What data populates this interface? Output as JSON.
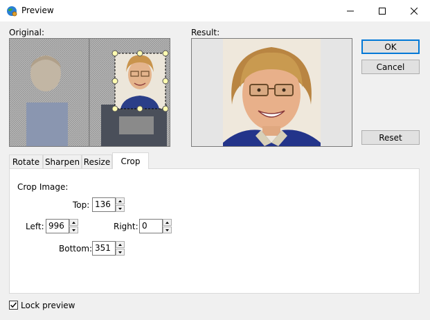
{
  "window": {
    "title": "Preview",
    "minimize_icon": "minimize-icon",
    "maximize_icon": "maximize-icon",
    "close_icon": "close-icon"
  },
  "original": {
    "label": "Original:",
    "image": "portrait-photo-with-crop-selection"
  },
  "result": {
    "label": "Result:",
    "image": "cropped-portrait-photo"
  },
  "buttons": {
    "ok": "OK",
    "cancel": "Cancel",
    "reset": "Reset"
  },
  "tabs": [
    {
      "label": "Rotate",
      "active": false
    },
    {
      "label": "Sharpen",
      "active": false
    },
    {
      "label": "Resize",
      "active": false
    },
    {
      "label": "Crop",
      "active": true
    }
  ],
  "crop": {
    "heading": "Crop Image:",
    "top_label": "Top:",
    "top_value": "136",
    "left_label": "Left:",
    "left_value": "996",
    "right_label": "Right:",
    "right_value": "0",
    "bottom_label": "Bottom:",
    "bottom_value": "351"
  },
  "lock_preview": {
    "label": "Lock preview",
    "checked": true
  },
  "colors": {
    "accent": "#0078d7",
    "window_bg": "#f0f0f0",
    "pane_border": "#7a7a7a"
  }
}
